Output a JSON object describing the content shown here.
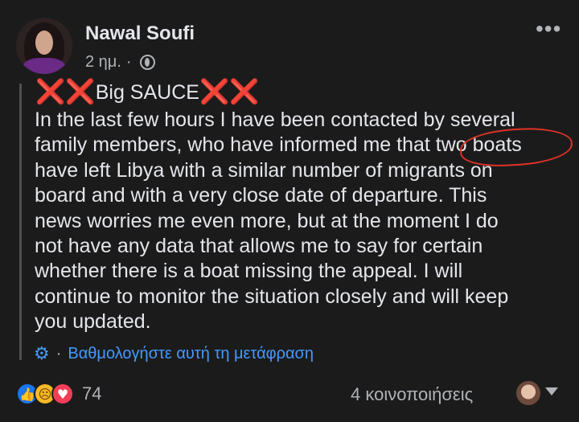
{
  "post": {
    "author": "Nawal Soufi",
    "timestamp": "2 ημ.",
    "separator": "·",
    "heading": "Big SAUCE",
    "heading_icons": [
      "❌❌",
      "❌❌"
    ],
    "body": "In the last few hours I have been contacted by several\nfamily members, who have informed me that two boats\nhave left Libya with a similar number of migrants on\nboard and with a very close date of departure. This\nnews worries me even more, but at the moment I do\nnot have any data that allows me to say for certain\nwhether there is a boat missing the appeal. I will\ncontinue to monitor the situation closely and will keep\nyou updated.",
    "translate": {
      "separator": "·",
      "link_label": "Βαθμολογήστε αυτή τη μετάφραση"
    },
    "reactions": {
      "count": "74",
      "icons": [
        "like-icon",
        "sad-icon",
        "love-icon"
      ]
    },
    "shares_label": "4 κοινοποιήσεις"
  },
  "colors": {
    "background": "#1b1b1b",
    "link": "#4599ff",
    "circle_annotation": "#e03226",
    "cross": "#e3242b"
  }
}
